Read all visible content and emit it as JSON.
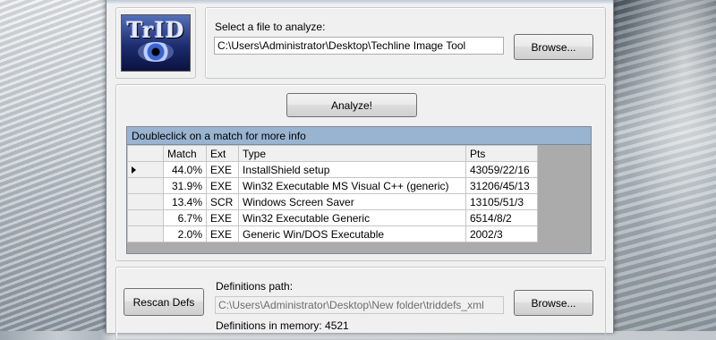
{
  "file_section": {
    "logo_text": "TrID",
    "select_label": "Select a file to analyze:",
    "file_path": "C:\\Users\\Administrator\\Desktop\\Techline Image Tool",
    "browse_label": "Browse..."
  },
  "analyze_label": "Analyze!",
  "results": {
    "caption": "Doubleclick on a match for more info",
    "headers": {
      "match": "Match",
      "ext": "Ext",
      "type": "Type",
      "pts": "Pts"
    },
    "rows": [
      {
        "match": "44.0%",
        "ext": "EXE",
        "type": "InstallShield setup",
        "pts": "43059/22/16"
      },
      {
        "match": "31.9%",
        "ext": "EXE",
        "type": "Win32 Executable MS Visual C++ (generic)",
        "pts": "31206/45/13"
      },
      {
        "match": "13.4%",
        "ext": "SCR",
        "type": "Windows Screen Saver",
        "pts": "13105/51/3"
      },
      {
        "match": "6.7%",
        "ext": "EXE",
        "type": "Win32 Executable Generic",
        "pts": "6514/8/2"
      },
      {
        "match": "2.0%",
        "ext": "EXE",
        "type": "Generic Win/DOS Executable",
        "pts": "2002/3"
      }
    ]
  },
  "definitions": {
    "rescan_label": "Rescan Defs",
    "path_label": "Definitions path:",
    "path_value": "C:\\Users\\Administrator\\Desktop\\New folder\\triddefs_xml",
    "browse_label": "Browse...",
    "memory_text": "Definitions in memory: 4521"
  },
  "colors": {
    "caption_bg": "#99b4d1",
    "window_bg": "#f0f0f0"
  }
}
